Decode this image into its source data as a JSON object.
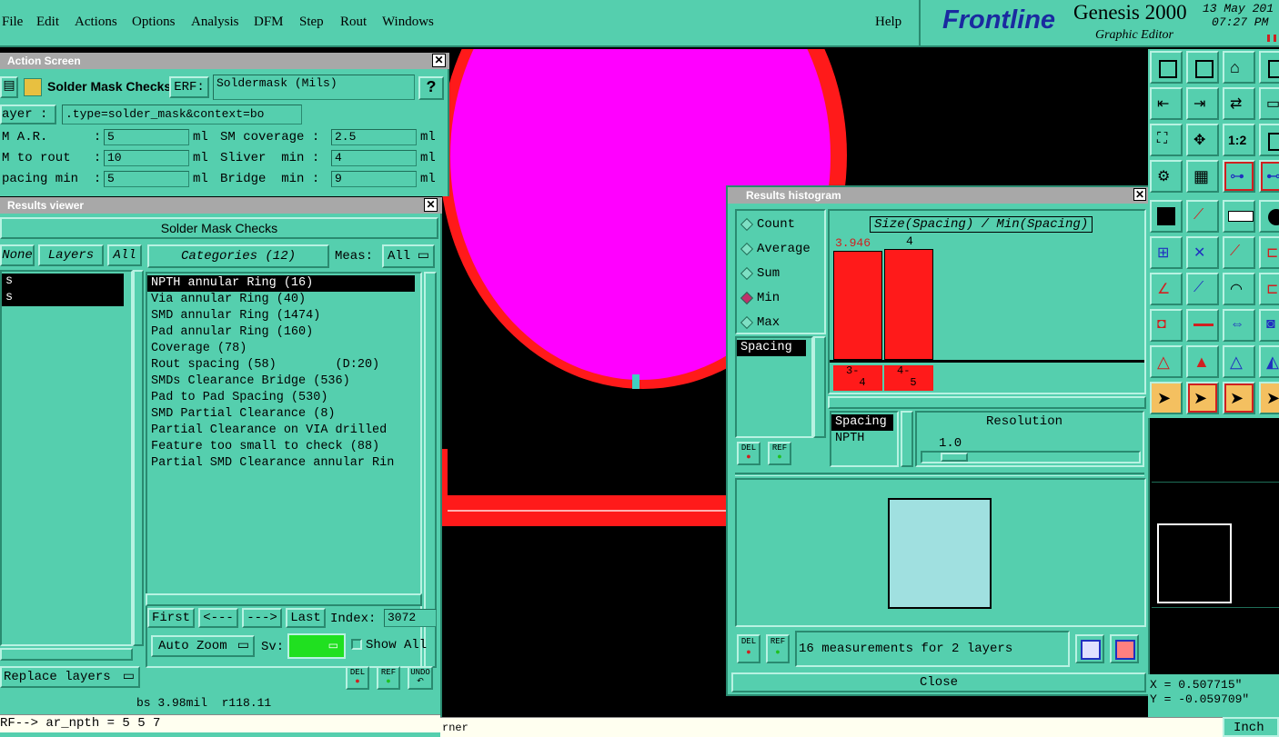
{
  "menubar": {
    "items": [
      "File",
      "Edit",
      "Actions",
      "Options",
      "Analysis",
      "DFM",
      "Step",
      "Rout",
      "Windows"
    ],
    "help": "Help",
    "brand": "Frontline",
    "product": "Genesis 2000",
    "subtitle": "Graphic Editor",
    "date": "13 May 201",
    "time": "07:27 PM"
  },
  "action_screen": {
    "title": "Action Screen",
    "name": "Solder Mask Checks",
    "erf_label": "ERF:",
    "erf_value": "Soldermask (Mils)",
    "help_label": "?",
    "layer_label": "ayer :",
    "layer_value": ".type=solder_mask&context=bo",
    "params": [
      {
        "label": "M A.R.      :",
        "value": "5",
        "unit": "ml",
        "label2": "SM coverage :",
        "value2": "2.5",
        "unit2": "ml"
      },
      {
        "label": "M to rout   :",
        "value": "10",
        "unit": "ml",
        "label2": "Sliver  min :",
        "value2": "4",
        "unit2": "ml"
      },
      {
        "label": "pacing min  :",
        "value": "5",
        "unit": "ml",
        "label2": "Bridge  min :",
        "value2": "9",
        "unit2": "ml"
      }
    ]
  },
  "results_viewer": {
    "title": "Results viewer",
    "header": "Solder Mask Checks",
    "none_btn": "None",
    "layers_btn": "Layers",
    "all_btn": "All",
    "layer_rows": [
      "s",
      "s"
    ],
    "categories_btn": "Categories (12)",
    "meas_label": "Meas:",
    "meas_value": "All",
    "categories": [
      "NPTH annular Ring (16)",
      "Via annular Ring (40)",
      "SMD annular Ring (1474)",
      "Pad annular Ring (160)",
      "Coverage (78)",
      "Rout spacing (58)        (D:20)",
      "SMDs Clearance Bridge (536)",
      "Pad to Pad Spacing (530)",
      "SMD Partial Clearance (8)",
      "Partial Clearance on VIA drilled",
      "Feature too small to check (88)",
      "Partial SMD Clearance annular Rin"
    ],
    "first_btn": "First",
    "prev_btn": "<---",
    "next_btn": "--->",
    "last_btn": "Last",
    "index_label": "Index:",
    "index_value": "3072",
    "zoom_btn": "Auto Zoom",
    "sv_label": "Sv:",
    "show_all": "Show All",
    "replace_btn": "Replace layers",
    "del_btn": "DEL",
    "ref_btn": "REF",
    "undo_btn": "UNDO",
    "status": "bs 3.98mil  r118.11"
  },
  "command_line": "RF--> ar_npth = 5 5 7",
  "bottom_status": "rner",
  "histogram": {
    "title": "Results histogram",
    "modes": [
      {
        "label": "Count",
        "selected": false
      },
      {
        "label": "Average",
        "selected": false
      },
      {
        "label": "Sum",
        "selected": false
      },
      {
        "label": "Min",
        "selected": true
      },
      {
        "label": "Max",
        "selected": false
      }
    ],
    "measure_list": [
      "Spacing"
    ],
    "chart_title": "Size(Spacing) / Min(Spacing)",
    "bars": [
      {
        "label_top": "3.946",
        "bin": "3-\n  4",
        "value": 3.946
      },
      {
        "label_top": "4",
        "bin": "4-\n  5",
        "value": 4
      }
    ],
    "list2": [
      "Spacing",
      "NPTH"
    ],
    "resolution_label": "Resolution",
    "resolution_value": "1.0",
    "del_btn": "DEL",
    "ref_btn": "REF",
    "summary": "16 measurements for 2 layers",
    "close_btn": "Close"
  },
  "coords": {
    "x": "X = 0.507715\"",
    "y": "Y = -0.059709\"",
    "units": "Inch"
  },
  "colors": {
    "panel": "#55cfae",
    "pad_fill": "#ff00ff",
    "pad_ring": "#ff1a1a",
    "bar": "#ff1a1a"
  }
}
